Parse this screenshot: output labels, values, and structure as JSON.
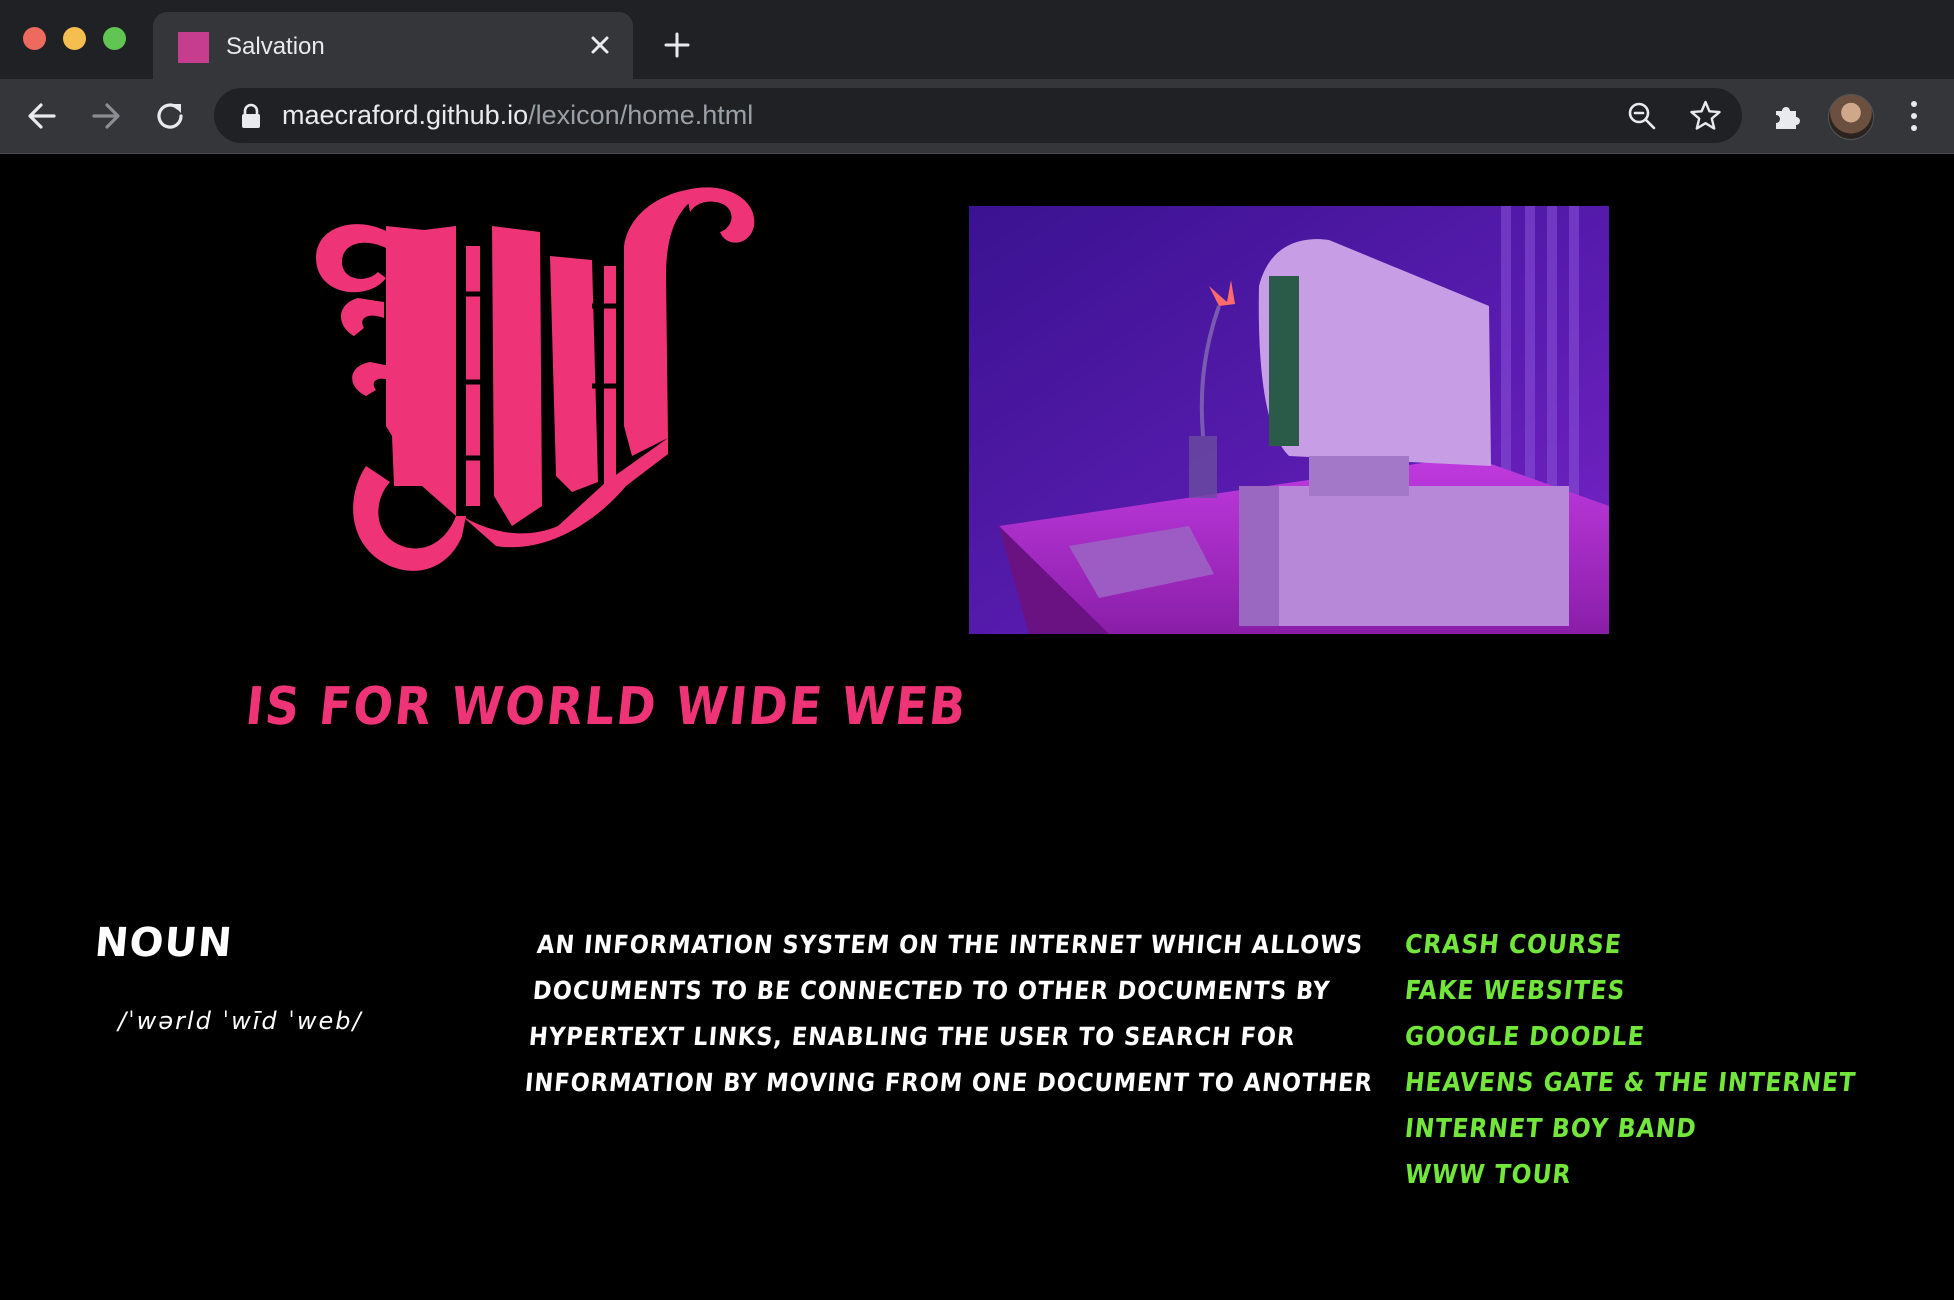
{
  "browser": {
    "tab_title": "Salvation",
    "url_host": "maecraford.github.io",
    "url_path": "/lexicon/home.html",
    "favicon_color": "#c53d8c"
  },
  "page": {
    "letter": "W",
    "headline": "is for world wide web",
    "part_of_speech": "Noun",
    "pronunciation": "/ˈwərld ˈwīd ˈweb/",
    "definition": "an information system on the internet which allows documents to be connected to other documents by hypertext links, enabling the user to search for information by moving from one document to another",
    "links": [
      "Crash Course",
      "Fake Websites",
      "Google Doodle",
      "Heavens Gate & the internet",
      "Internet Boy Band",
      "WWW Tour"
    ],
    "colors": {
      "accent_pink": "#ee3377",
      "link_green": "#72e63a",
      "text_white": "#ffffff",
      "background": "#000000"
    }
  }
}
